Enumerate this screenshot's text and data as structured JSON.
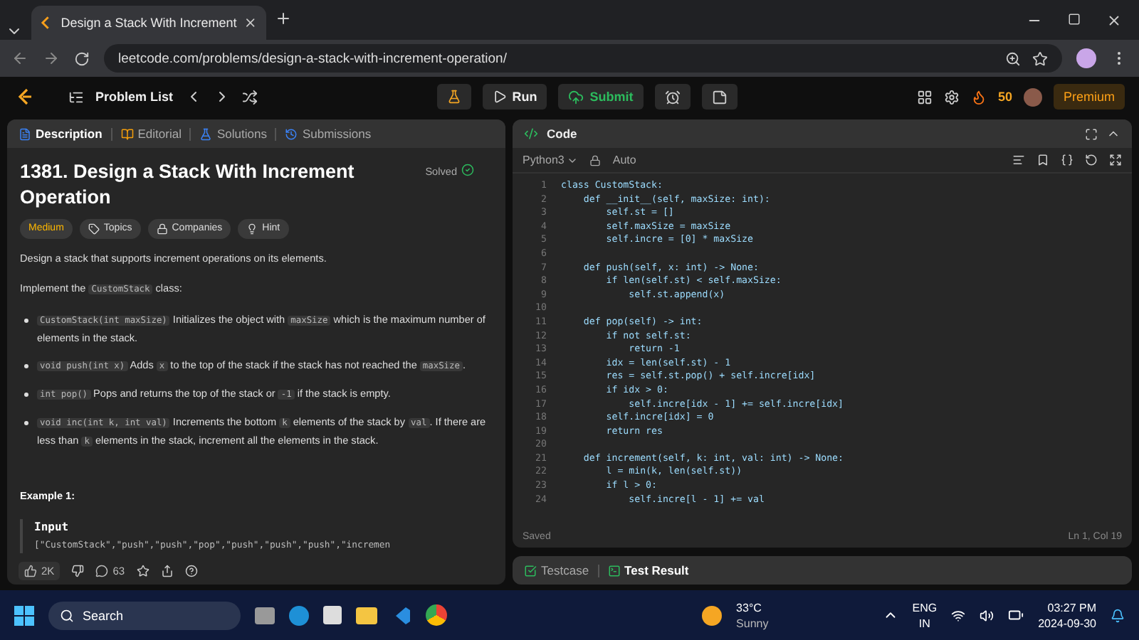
{
  "browser": {
    "tab_title": "Design a Stack With Increment",
    "url": "leetcode.com/problems/design-a-stack-with-increment-operation/"
  },
  "nav": {
    "problem_list": "Problem List",
    "run": "Run",
    "submit": "Submit",
    "streak": "50",
    "premium": "Premium"
  },
  "left_tabs": [
    {
      "label": "Description",
      "selected": true
    },
    {
      "label": "Editorial",
      "selected": false
    },
    {
      "label": "Solutions",
      "selected": false
    },
    {
      "label": "Submissions",
      "selected": false
    }
  ],
  "problem": {
    "title": "1381. Design a Stack With Increment Operation",
    "status": "Solved",
    "difficulty": "Medium",
    "tags": [
      "Topics",
      "Companies",
      "Hint"
    ],
    "paragraphs": [
      [
        {
          "kind": "text",
          "text": "Design a stack that supports increment operations on its elements."
        }
      ],
      [
        {
          "kind": "text",
          "text": "Implement the "
        },
        {
          "kind": "code",
          "text": "CustomStack"
        },
        {
          "kind": "text",
          "text": " class:"
        }
      ]
    ],
    "bullets": [
      [
        {
          "kind": "code",
          "text": "CustomStack(int maxSize)"
        },
        {
          "kind": "text",
          "text": " Initializes the object with "
        },
        {
          "kind": "code",
          "text": "maxSize"
        },
        {
          "kind": "text",
          "text": " which is the maximum number of elements in the stack."
        }
      ],
      [
        {
          "kind": "code",
          "text": "void push(int x)"
        },
        {
          "kind": "text",
          "text": " Adds "
        },
        {
          "kind": "code",
          "text": "x"
        },
        {
          "kind": "text",
          "text": " to the top of the stack if the stack has not reached the "
        },
        {
          "kind": "code",
          "text": "maxSize"
        },
        {
          "kind": "text",
          "text": "."
        }
      ],
      [
        {
          "kind": "code",
          "text": "int pop()"
        },
        {
          "kind": "text",
          "text": " Pops and returns the top of the stack or "
        },
        {
          "kind": "code",
          "text": "-1"
        },
        {
          "kind": "text",
          "text": " if the stack is empty."
        }
      ],
      [
        {
          "kind": "code",
          "text": "void inc(int k, int val)"
        },
        {
          "kind": "text",
          "text": " Increments the bottom "
        },
        {
          "kind": "code",
          "text": "k"
        },
        {
          "kind": "text",
          "text": " elements of the stack by "
        },
        {
          "kind": "code",
          "text": "val"
        },
        {
          "kind": "text",
          "text": ". If there are less than "
        },
        {
          "kind": "code",
          "text": "k"
        },
        {
          "kind": "text",
          "text": " elements in the stack, increment all the elements in the stack."
        }
      ]
    ],
    "example_title": "Example 1:",
    "input_label": "Input",
    "input_text": "[\"CustomStack\",\"push\",\"push\",\"pop\",\"push\",\"push\",\"push\",\"incremen"
  },
  "footer": {
    "likes": "2K",
    "comments": "63"
  },
  "code_panel": {
    "title": "Code",
    "language": "Python3",
    "mode": "Auto",
    "status": "Saved",
    "cursor": "Ln 1, Col 19",
    "lines": [
      {
        "number": "1",
        "text": "class CustomStack:"
      },
      {
        "number": "2",
        "text": "    def __init__(self, maxSize: int):"
      },
      {
        "number": "3",
        "text": "        self.st = []"
      },
      {
        "number": "4",
        "text": "        self.maxSize = maxSize"
      },
      {
        "number": "5",
        "text": "        self.incre = [0] * maxSize"
      },
      {
        "number": "6"
      },
      {
        "number": "7",
        "text": "    def push(self, x: int) -> None:"
      },
      {
        "number": "8",
        "text": "        if len(self.st) < self.maxSize:"
      },
      {
        "number": "9",
        "text": "            self.st.append(x)"
      },
      {
        "number": "10"
      },
      {
        "number": "11",
        "text": "    def pop(self) -> int:"
      },
      {
        "number": "12",
        "text": "        if not self.st:"
      },
      {
        "number": "13",
        "text": "            return -1"
      },
      {
        "number": "14",
        "text": "        idx = len(self.st) - 1"
      },
      {
        "number": "15",
        "text": "        res = self.st.pop() + self.incre[idx]"
      },
      {
        "number": "16",
        "text": "        if idx > 0:"
      },
      {
        "number": "17",
        "text": "            self.incre[idx - 1] += self.incre[idx]"
      },
      {
        "number": "18",
        "text": "        self.incre[idx] = 0"
      },
      {
        "number": "19",
        "text": "        return res"
      },
      {
        "number": "20"
      },
      {
        "number": "21",
        "text": "    def increment(self, k: int, val: int) -> None:"
      },
      {
        "number": "22",
        "text": "        l = min(k, len(self.st))"
      },
      {
        "number": "23",
        "text": "        if l > 0:"
      },
      {
        "number": "24",
        "text": "            self.incre[l - 1] += val"
      }
    ]
  },
  "bottom_tabs": [
    {
      "label": "Testcase",
      "selected": false
    },
    {
      "label": "Test Result",
      "selected": true
    }
  ],
  "taskbar": {
    "search": "Search",
    "temperature": "33°C",
    "weather": "Sunny",
    "lang": "ENG",
    "region": "IN",
    "time": "03:27 PM",
    "date": "2024-09-30"
  }
}
